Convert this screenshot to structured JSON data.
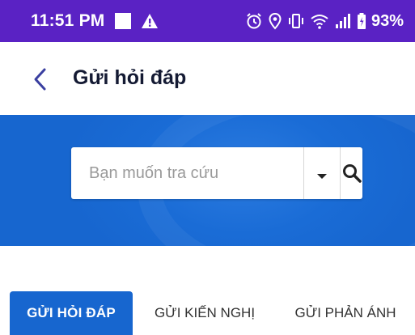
{
  "status_bar": {
    "time": "11:51 PM",
    "battery": "93%",
    "background": "#5a22c4",
    "icons": [
      "notification-square-icon",
      "warning-icon",
      "alarm-icon",
      "location-icon",
      "vibrate-icon",
      "wifi-icon",
      "signal-icon",
      "battery-icon"
    ]
  },
  "header": {
    "title": "Gửi hỏi đáp",
    "back_icon": "chevron-left-icon"
  },
  "search": {
    "placeholder": "Bạn muốn tra cứu",
    "dropdown_icon": "caret-down-icon",
    "search_icon": "magnifier-icon"
  },
  "tabs": [
    {
      "label": "GỬI HỎI ĐÁP",
      "active": true
    },
    {
      "label": "GỬI KIẾN NGHỊ",
      "active": false
    },
    {
      "label": "GỬI PHẢN ÁNH",
      "active": false
    }
  ],
  "colors": {
    "accent": "#1766cf",
    "title": "#141a33",
    "back_icon": "#3a3fa0"
  }
}
